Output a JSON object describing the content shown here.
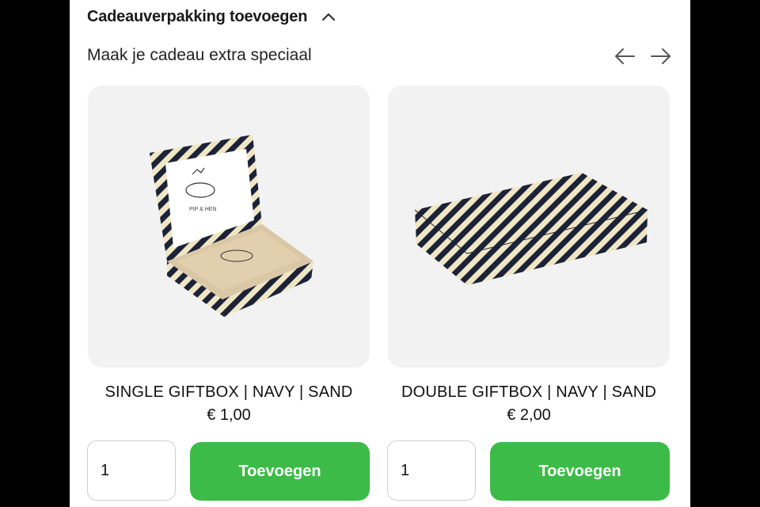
{
  "section": {
    "title": "Cadeauverpakking toevoegen",
    "subtitle": "Maak je cadeau extra speciaal",
    "expanded": true
  },
  "carousel": {
    "prev_icon": "arrow-left-icon",
    "next_icon": "arrow-right-icon"
  },
  "products": [
    {
      "name": "SINGLE GIFTBOX | NAVY | SAND",
      "price": "€ 1,00",
      "quantity": "1",
      "button_label": "Toevoegen"
    },
    {
      "name": "DOUBLE GIFTBOX | NAVY | SAND",
      "price": "€ 2,00",
      "quantity": "1",
      "button_label": "Toevoegen"
    }
  ],
  "colors": {
    "accent_green": "#3dbb48",
    "box_navy": "#1c2238",
    "box_sand": "#efe6c4",
    "card_background": "#f2f2f2"
  }
}
